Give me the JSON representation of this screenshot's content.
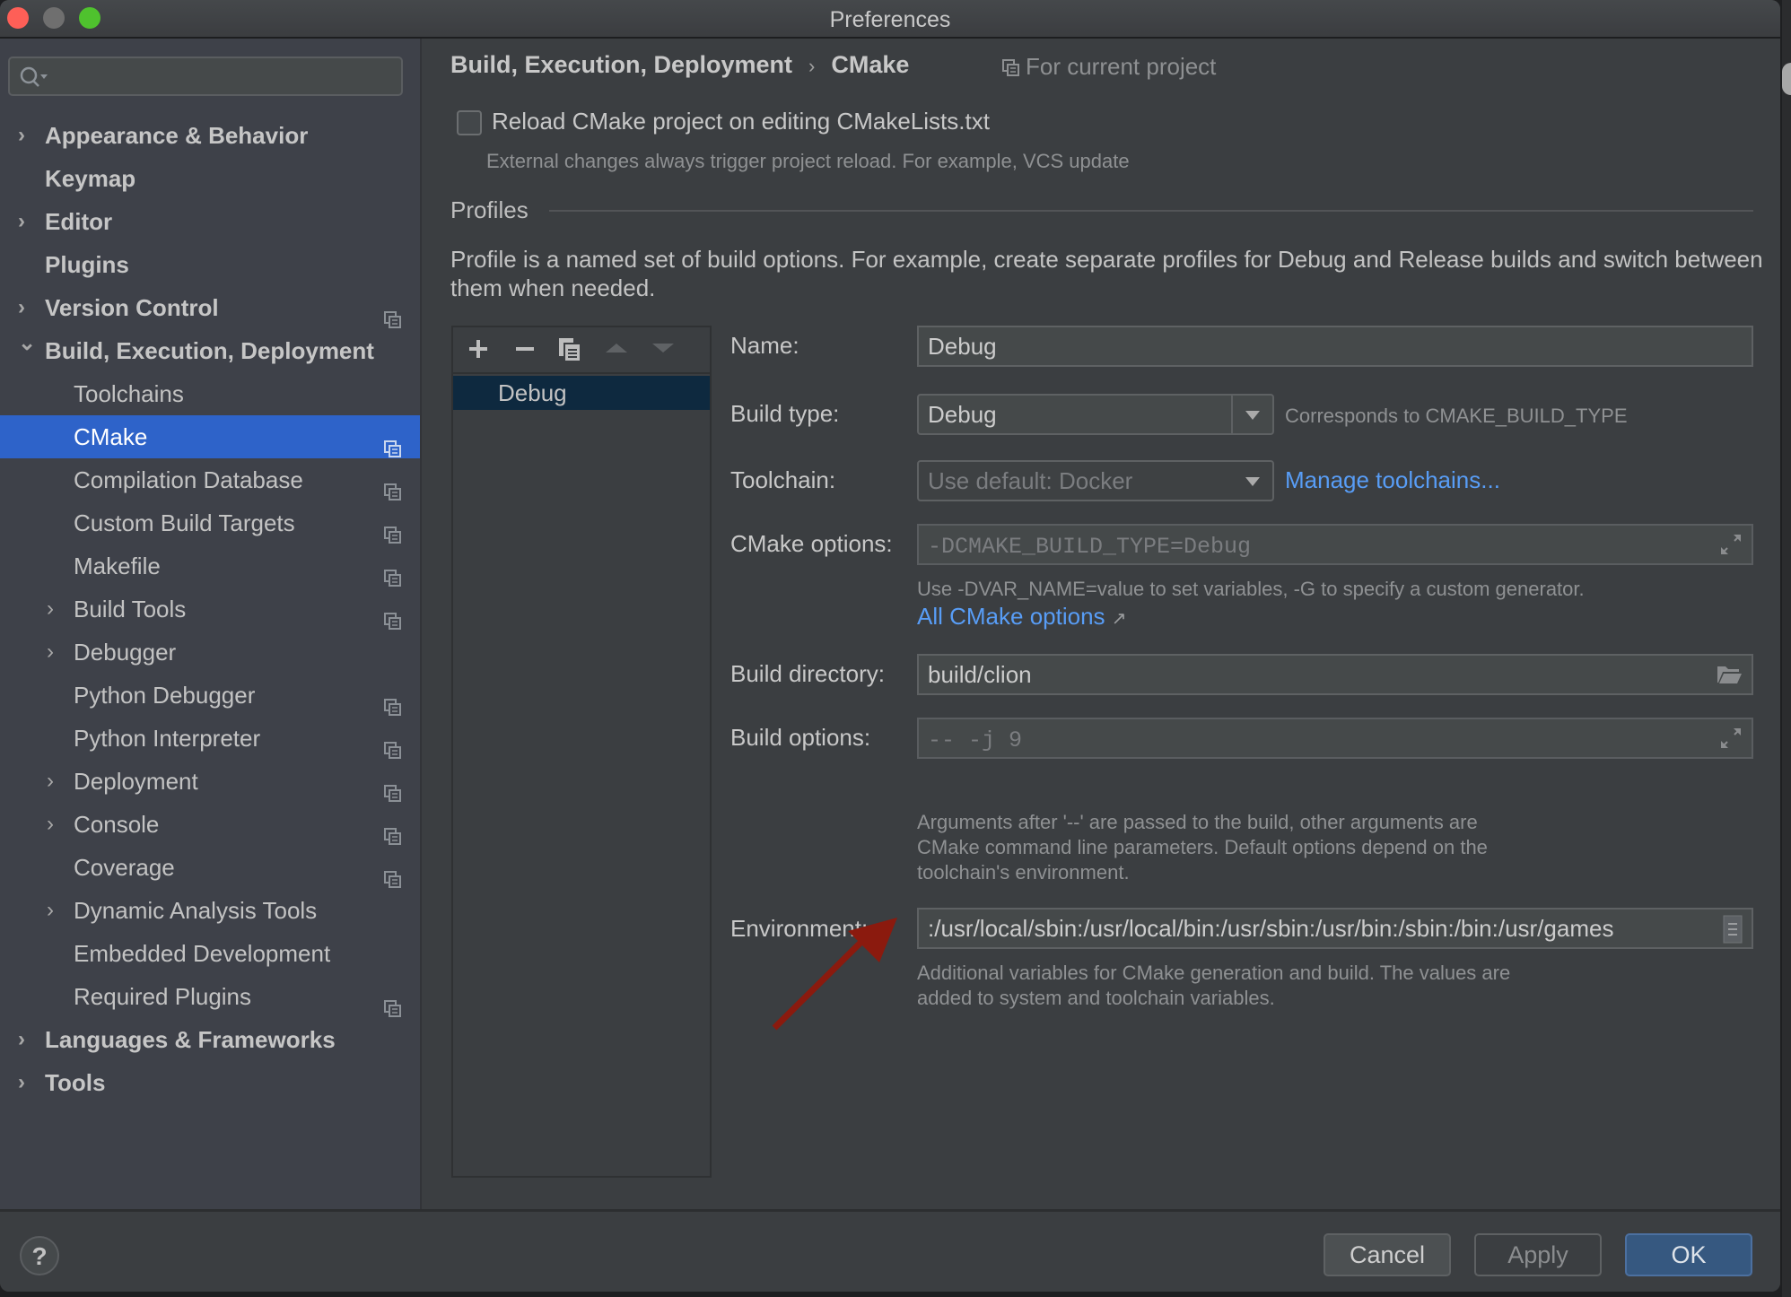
{
  "window": {
    "title": "Preferences"
  },
  "sidebar": {
    "search": {
      "placeholder": "",
      "value": ""
    },
    "items": [
      {
        "label": "Appearance & Behavior",
        "level": 0,
        "bold": true,
        "expandable": true,
        "expanded": false,
        "project_icon": false
      },
      {
        "label": "Keymap",
        "level": 0,
        "bold": true,
        "expandable": false,
        "project_icon": false
      },
      {
        "label": "Editor",
        "level": 0,
        "bold": true,
        "expandable": true,
        "expanded": false,
        "project_icon": false
      },
      {
        "label": "Plugins",
        "level": 0,
        "bold": true,
        "expandable": false,
        "project_icon": false
      },
      {
        "label": "Version Control",
        "level": 0,
        "bold": true,
        "expandable": true,
        "expanded": false,
        "project_icon": true
      },
      {
        "label": "Build, Execution, Deployment",
        "level": 0,
        "bold": true,
        "expandable": true,
        "expanded": true,
        "project_icon": false
      },
      {
        "label": "Toolchains",
        "level": 1,
        "bold": false,
        "expandable": false,
        "project_icon": false
      },
      {
        "label": "CMake",
        "level": 1,
        "bold": false,
        "expandable": false,
        "project_icon": true,
        "selected": true
      },
      {
        "label": "Compilation Database",
        "level": 1,
        "bold": false,
        "expandable": false,
        "project_icon": true
      },
      {
        "label": "Custom Build Targets",
        "level": 1,
        "bold": false,
        "expandable": false,
        "project_icon": true
      },
      {
        "label": "Makefile",
        "level": 1,
        "bold": false,
        "expandable": false,
        "project_icon": true
      },
      {
        "label": "Build Tools",
        "level": 1,
        "bold": false,
        "expandable": true,
        "expanded": false,
        "project_icon": true
      },
      {
        "label": "Debugger",
        "level": 1,
        "bold": false,
        "expandable": true,
        "expanded": false,
        "project_icon": false
      },
      {
        "label": "Python Debugger",
        "level": 1,
        "bold": false,
        "expandable": false,
        "project_icon": true
      },
      {
        "label": "Python Interpreter",
        "level": 1,
        "bold": false,
        "expandable": false,
        "project_icon": true
      },
      {
        "label": "Deployment",
        "level": 1,
        "bold": false,
        "expandable": true,
        "expanded": false,
        "project_icon": true
      },
      {
        "label": "Console",
        "level": 1,
        "bold": false,
        "expandable": true,
        "expanded": false,
        "project_icon": true
      },
      {
        "label": "Coverage",
        "level": 1,
        "bold": false,
        "expandable": false,
        "project_icon": true
      },
      {
        "label": "Dynamic Analysis Tools",
        "level": 1,
        "bold": false,
        "expandable": true,
        "expanded": false,
        "project_icon": false
      },
      {
        "label": "Embedded Development",
        "level": 1,
        "bold": false,
        "expandable": false,
        "project_icon": false
      },
      {
        "label": "Required Plugins",
        "level": 1,
        "bold": false,
        "expandable": false,
        "project_icon": true
      },
      {
        "label": "Languages & Frameworks",
        "level": 0,
        "bold": true,
        "expandable": true,
        "expanded": false,
        "project_icon": false
      },
      {
        "label": "Tools",
        "level": 0,
        "bold": true,
        "expandable": true,
        "expanded": false,
        "project_icon": false
      }
    ]
  },
  "main": {
    "breadcrumb": {
      "parent": "Build, Execution, Deployment",
      "separator": "›",
      "current": "CMake"
    },
    "scope_label": "For current project",
    "reload_checkbox": {
      "label": "Reload CMake project on editing CMakeLists.txt",
      "checked": false,
      "hint": "External changes always trigger project reload. For example, VCS update"
    },
    "profiles_section": {
      "title": "Profiles",
      "description": "Profile is a named set of build options. For example, create separate profiles for Debug and Release builds and switch between them when needed."
    },
    "profile_list": {
      "toolbar": [
        "add-icon",
        "remove-icon",
        "copy-icon",
        "move-up-icon",
        "move-down-icon"
      ],
      "items": [
        {
          "label": "Debug",
          "selected": true
        }
      ]
    },
    "form": {
      "name": {
        "label": "Name:",
        "value": "Debug"
      },
      "build_type": {
        "label": "Build type:",
        "value": "Debug",
        "hint": "Corresponds to CMAKE_BUILD_TYPE"
      },
      "toolchain": {
        "label": "Toolchain:",
        "value": "Use default: Docker",
        "link": "Manage toolchains..."
      },
      "cmake_options": {
        "label": "CMake options:",
        "placeholder": "-DCMAKE_BUILD_TYPE=Debug",
        "value": "",
        "hint": "Use -DVAR_NAME=value to set variables, -G to specify a custom generator.",
        "link": "All CMake options",
        "link_icon": "↗"
      },
      "build_directory": {
        "label": "Build directory:",
        "value": "build/clion"
      },
      "build_options": {
        "label": "Build options:",
        "placeholder": "-- -j 9",
        "value": "",
        "hint_lines": [
          "Arguments after '--' are passed to the build, other arguments are",
          "CMake command line parameters. Default options depend on the",
          "toolchain's environment."
        ]
      },
      "environment": {
        "label": "Environment:",
        "value": ":/usr/local/sbin:/usr/local/bin:/usr/sbin:/usr/bin:/sbin:/bin:/usr/games",
        "hint_lines": [
          "Additional variables for CMake generation and build. The values are",
          "added to system and toolchain variables."
        ]
      }
    },
    "annotation": {
      "type": "arrow",
      "color": "#8b1a0e",
      "points_to": "environment-field"
    }
  },
  "footer": {
    "help_label": "?",
    "cancel_label": "Cancel",
    "apply_label": "Apply",
    "ok_label": "OK"
  },
  "colors": {
    "selection": "#2e63c9",
    "link": "#589df6",
    "ok_button": "#365880",
    "profile_selection": "#0e293f"
  }
}
